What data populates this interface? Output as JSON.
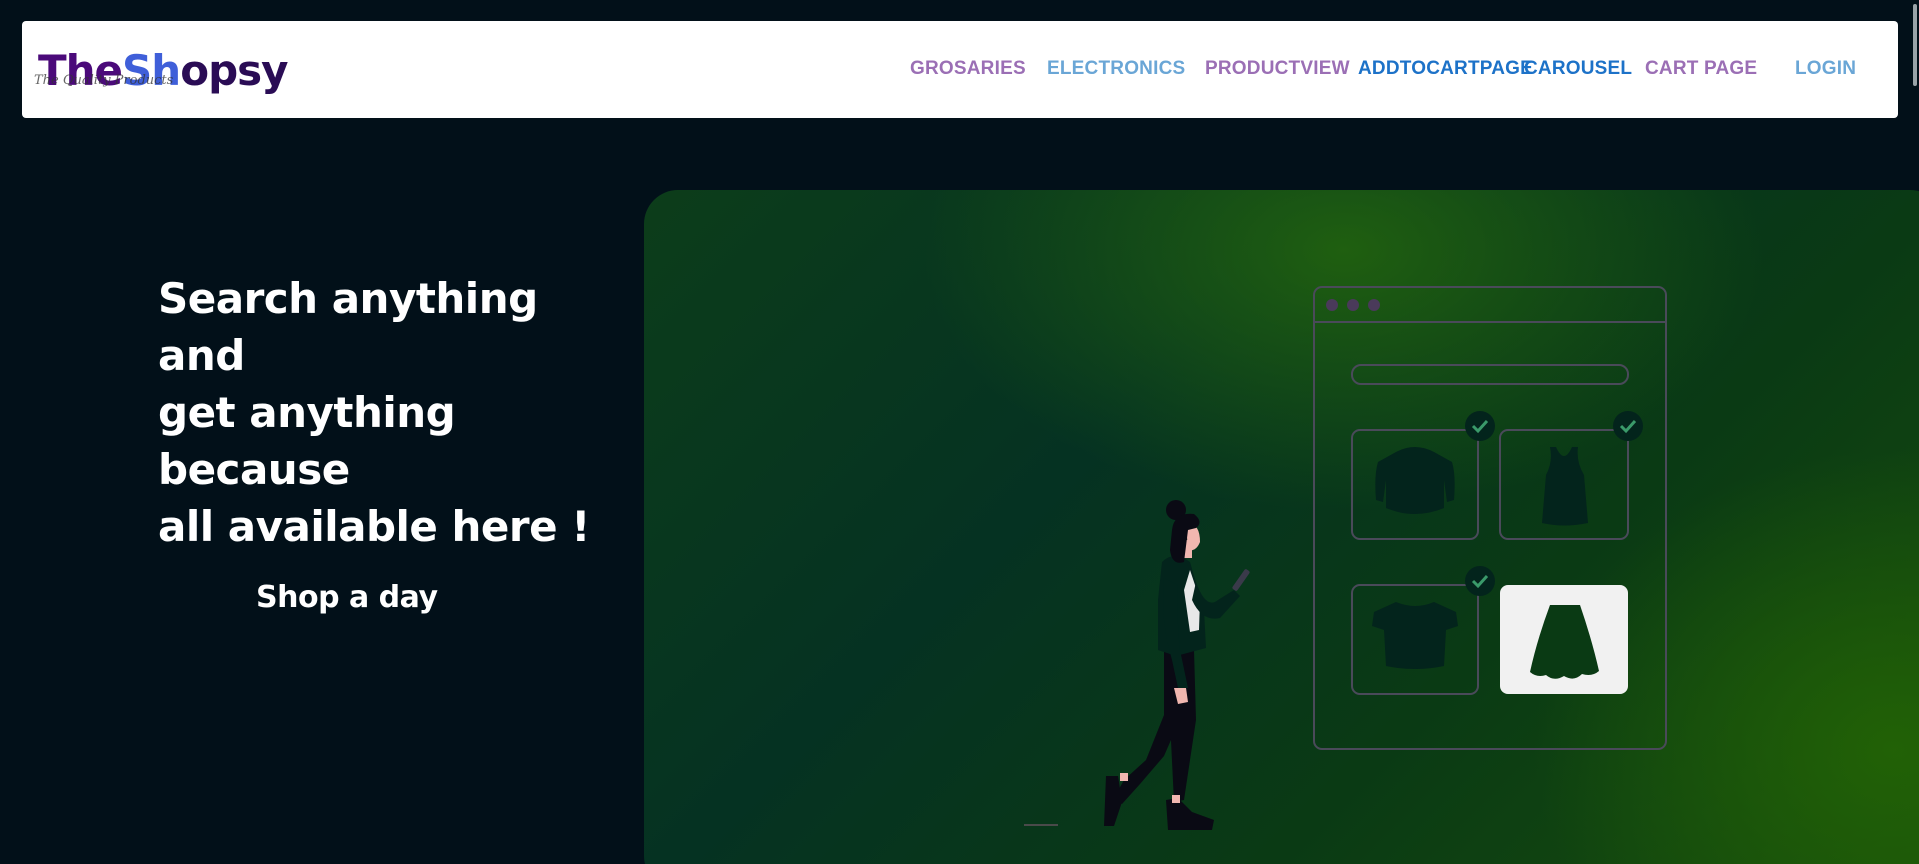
{
  "brand": {
    "name_parts": [
      "The",
      "Sh",
      "o",
      "psy"
    ],
    "tagline": "The Quality Products"
  },
  "nav": {
    "items": [
      {
        "label": "GROSARIES",
        "color": "#9b6fb5"
      },
      {
        "label": "ELECTRONICS",
        "color": "#6aa6d6"
      },
      {
        "label": "PRODUCTVIEW",
        "color": "#9b6fb5"
      },
      {
        "label": "ADDTOCARTPAGE",
        "color": "#1d72c8"
      },
      {
        "label": "CAROUSEL",
        "color": "#1d72c8"
      },
      {
        "label": "CART PAGE",
        "color": "#9b6fb5"
      },
      {
        "label": "LOGIN",
        "color": "#6aa6d6"
      }
    ]
  },
  "hero": {
    "lines": [
      "Search anything",
      "and",
      "get anything",
      "because",
      "all available here !"
    ],
    "subtitle": "Shop a day"
  },
  "colors": {
    "background": "#021019",
    "panel_green": "#0a3a14",
    "accent_green": "#1f5c0a",
    "product_dark": "#03241c"
  },
  "illustration": {
    "icons": [
      "browser-window-icon",
      "jacket-icon",
      "tank-top-icon",
      "crop-top-icon",
      "skirt-icon",
      "checkmark-icon",
      "woman-with-phone-illustration"
    ]
  }
}
